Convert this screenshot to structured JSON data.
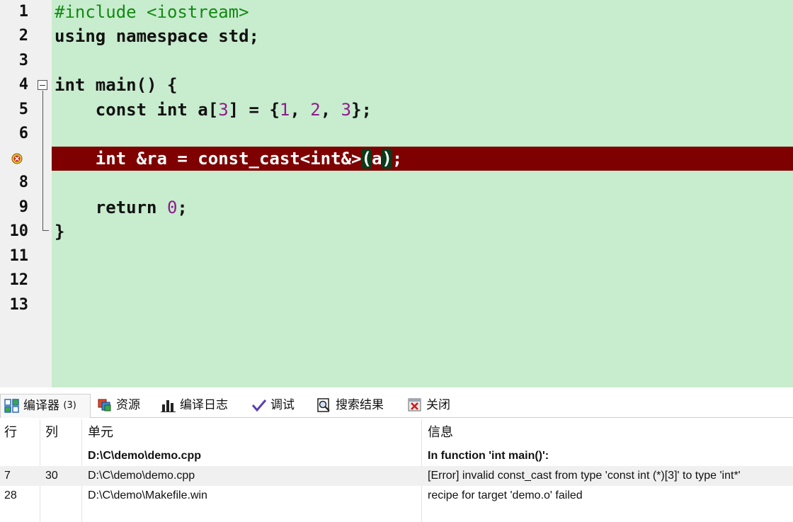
{
  "editor": {
    "line_numbers": [
      "1",
      "2",
      "3",
      "4",
      "5",
      "6",
      "7",
      "8",
      "9",
      "10",
      "11",
      "12",
      "13"
    ],
    "error_line": "7"
  },
  "code": {
    "l1_pp": "#include <iostream>",
    "l2": "using namespace std;",
    "l4": "int main() {",
    "l5_a": "    const int a[",
    "l5_n3": "3",
    "l5_b": "] = {",
    "l5_n1": "1",
    "l5_c": ", ",
    "l5_n2": "2",
    "l5_d": ", ",
    "l5_n3b": "3",
    "l5_e": "};",
    "l7_a": "    int &ra = const_cast<int&>",
    "l7_hl1": "(",
    "l7_b": "a",
    "l7_hl2": ")",
    "l7_c": ";",
    "l9_a": "    return ",
    "l9_n0": "0",
    "l9_b": ";",
    "l10": "}"
  },
  "tabs": {
    "compiler": "编译器",
    "compiler_count": "(3)",
    "resources": "资源",
    "compile_log": "编译日志",
    "debug": "调试",
    "search_results": "搜索结果",
    "close": "关闭"
  },
  "messages": {
    "columns": [
      "行",
      "列",
      "单元",
      "信息"
    ],
    "rows": [
      {
        "line": "",
        "col": "",
        "unit": "D:\\C\\demo\\demo.cpp",
        "info": "In function 'int main()':",
        "bold": true
      },
      {
        "line": "7",
        "col": "30",
        "unit": "D:\\C\\demo\\demo.cpp",
        "info": "[Error] invalid const_cast from type 'const int (*)[3]' to type 'int*'"
      },
      {
        "line": "28",
        "col": "",
        "unit": "D:\\C\\demo\\Makefile.win",
        "info": "recipe for target 'demo.o' failed"
      }
    ]
  },
  "colors": {
    "editor_bg": "#c8ecce",
    "error_line_bg": "#7f0000",
    "preprocessor": "#128a12",
    "number": "#8e1b8e"
  }
}
